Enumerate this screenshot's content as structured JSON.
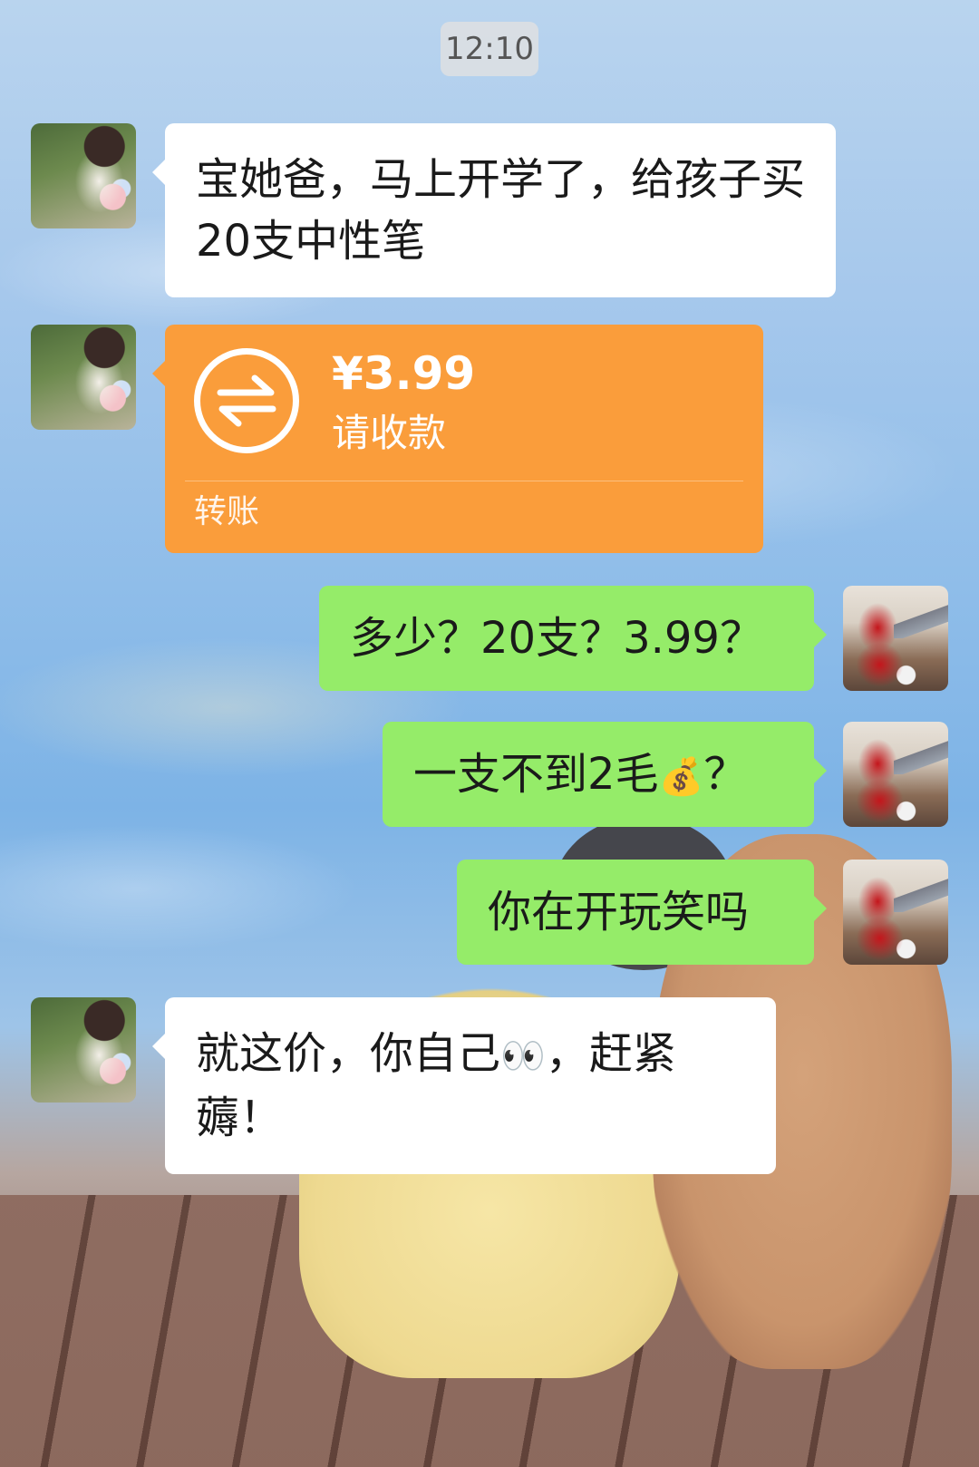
{
  "timestamp": "12:10",
  "messages": [
    {
      "sender": "wife",
      "type": "text",
      "text": "宝她爸，马上开学了，给孩子买20支中性笔"
    },
    {
      "sender": "wife",
      "type": "transfer",
      "amount": "¥3.99",
      "status": "请收款",
      "label": "转账"
    },
    {
      "sender": "me",
      "type": "text",
      "text": "多少？20支？3.99？"
    },
    {
      "sender": "me",
      "type": "text",
      "text_before": "一支不到2毛",
      "emoji": "💰",
      "text_after": "？"
    },
    {
      "sender": "me",
      "type": "text",
      "text": "你在开玩笑吗"
    },
    {
      "sender": "wife",
      "type": "text",
      "text_before": "就这价，你自己",
      "emoji": "👀",
      "text_after": "，赶紧薅！"
    }
  ],
  "colors": {
    "my_bubble": "#95ec69",
    "their_bubble": "#ffffff",
    "transfer_card": "#fa9d3b"
  },
  "icons": {
    "transfer": "transfer-arrows-icon",
    "wife_avatar": "avatar-photo",
    "me_avatar": "avatar-photo"
  }
}
